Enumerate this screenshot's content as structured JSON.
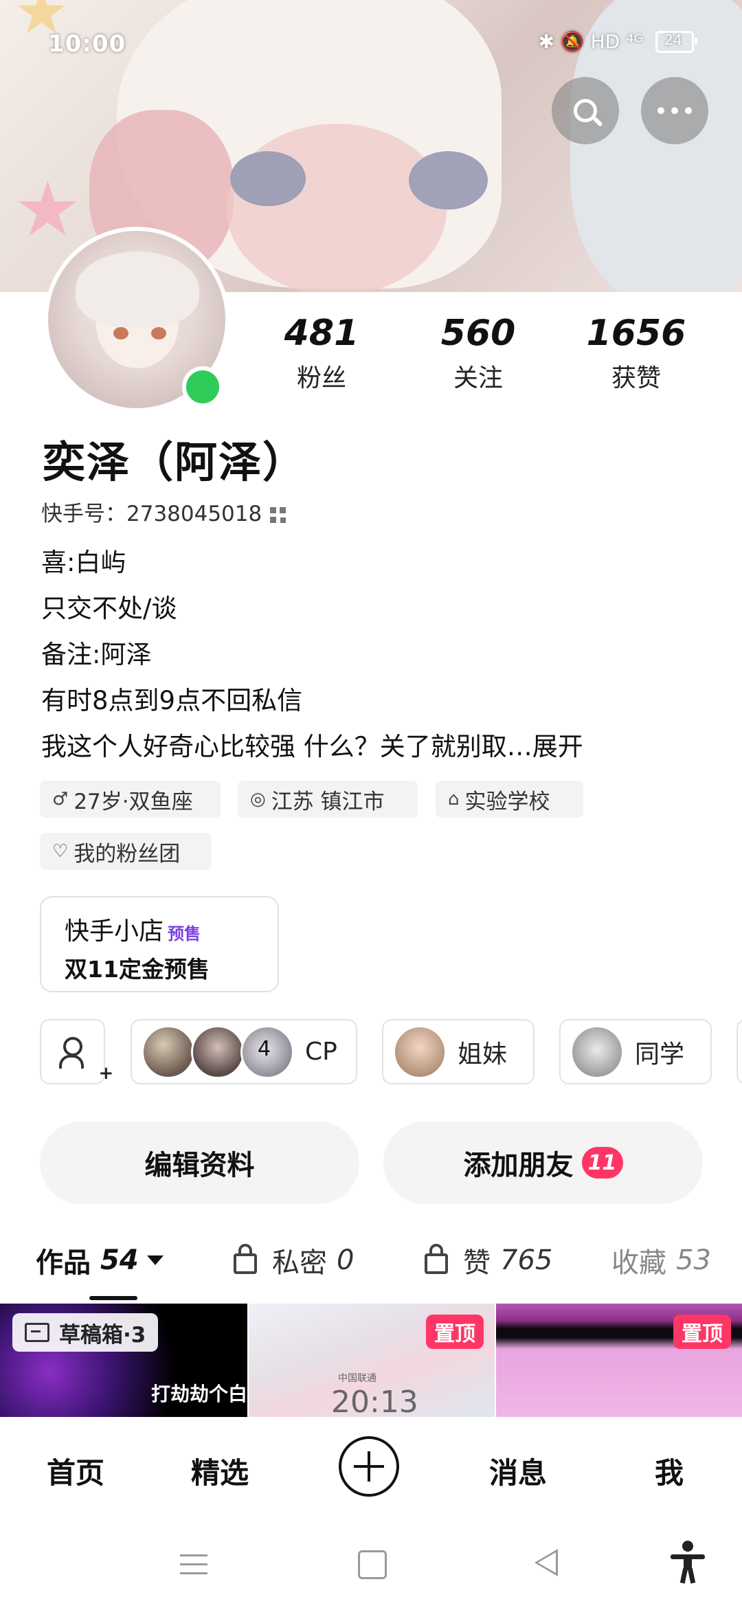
{
  "status_bar": {
    "time": "10:00",
    "indicators": "✱ 🔕 HD ⁴ᴳ",
    "battery_level": "24"
  },
  "profile": {
    "stats": [
      {
        "value": "481",
        "label": "粉丝"
      },
      {
        "value": "560",
        "label": "关注"
      },
      {
        "value": "1656",
        "label": "获赞"
      }
    ],
    "name": "奕泽（阿泽）",
    "kuaishou_id": "快手号：2738045018",
    "bio": [
      "喜:白屿",
      "只交不处/谈",
      "备注:阿泽",
      "有时8点到9点不回私信",
      "我这个人好奇心比较强 什么？关了就别取…展开"
    ],
    "tags": [
      {
        "icon": "♂",
        "text": "27岁·双鱼座"
      },
      {
        "icon": "◎",
        "text": "江苏 镇江市"
      },
      {
        "icon": "⌂",
        "text": "实验学校"
      },
      {
        "icon": "♡",
        "text": "我的粉丝团"
      }
    ],
    "online_color": "#2fcc5a"
  },
  "shop": {
    "title": "快手小店",
    "badge": "预售",
    "subtitle": "双11定金预售"
  },
  "groups": [
    {
      "label": "CP",
      "extra": "4"
    },
    {
      "label": "姐妹"
    },
    {
      "label": "同学"
    }
  ],
  "actions": {
    "edit": "编辑资料",
    "add_friend": "添加朋友",
    "add_friend_badge": "11",
    "accent": "#fe3666"
  },
  "tabs": [
    {
      "label": "作品",
      "count": "54"
    },
    {
      "label": "私密",
      "count": "0"
    },
    {
      "label": "赞",
      "count": "765"
    },
    {
      "label": "收藏",
      "count": "53"
    }
  ],
  "thumbnails": {
    "draft": "草稿箱·3",
    "first_caption": "打劫劫个白",
    "pinned": "置顶",
    "second_time": "20:13",
    "second_small": "中国联通"
  },
  "bottom_nav": {
    "home": "首页",
    "featured": "精选",
    "messages": "消息",
    "me": "我"
  }
}
